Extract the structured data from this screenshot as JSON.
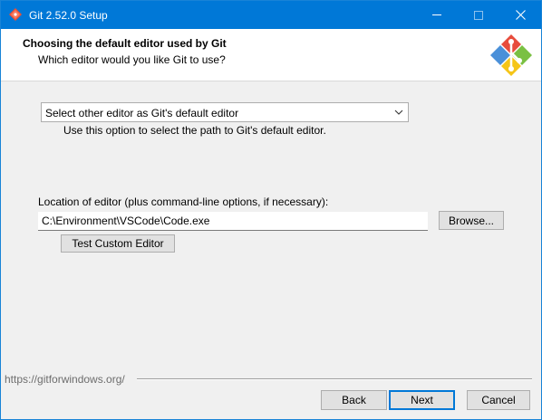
{
  "window": {
    "title": "Git 2.52.0 Setup",
    "app_icon": "git-setup-icon",
    "controls": [
      "minimize-icon",
      "maximize-icon",
      "close-icon"
    ]
  },
  "header": {
    "title": "Choosing the default editor used by Git",
    "subtitle": "Which editor would you like Git to use?",
    "logo": "git-logo-icon"
  },
  "editor_select": {
    "value": "Select other editor as Git's default editor",
    "help": "Use this option to select the path to Git's default editor."
  },
  "location": {
    "label": "Location of editor (plus command-line options, if necessary):",
    "value": "C:\\Environment\\VSCode\\Code.exe",
    "browse_label": "Browse...",
    "test_label": "Test Custom Editor"
  },
  "footer": {
    "link": "https://gitforwindows.org/",
    "back_label": "Back",
    "next_label": "Next",
    "cancel_label": "Cancel"
  },
  "colors": {
    "titlebar": "#0078d7",
    "accent": "#0078d7",
    "logo_red": "#e74c3c",
    "logo_green": "#7ac043",
    "logo_blue": "#4a90d9",
    "logo_yellow": "#f5c518"
  }
}
